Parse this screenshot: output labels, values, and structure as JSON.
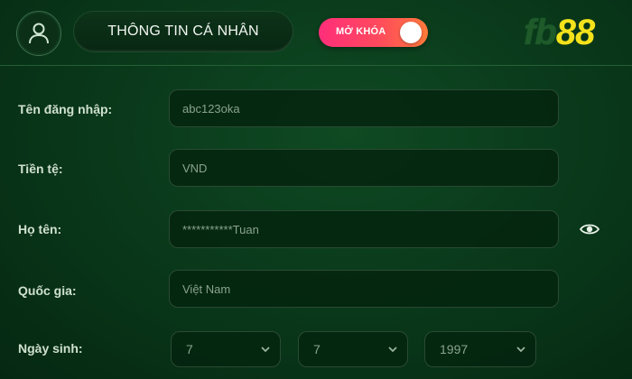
{
  "header": {
    "title": "THÔNG TIN CÁ NHÂN",
    "toggle_label": "MỞ KHÓA",
    "logo_fb": "fb",
    "logo_num": "88",
    "avatar_icon": "user-icon"
  },
  "colors": {
    "background": "#0a3a1b",
    "toggle_gradient_start": "#ff2e7a",
    "toggle_gradient_end": "#ff7a3a",
    "logo_number": "#f4e21b"
  },
  "form": {
    "username": {
      "label": "Tên đăng nhập:",
      "value": "abc123oka"
    },
    "currency": {
      "label": "Tiền tệ:",
      "value": "VND"
    },
    "fullname": {
      "label": "Họ tên:",
      "value": "***********Tuan",
      "reveal_icon": "eye-icon"
    },
    "country": {
      "label": "Quốc gia:",
      "value": "Việt Nam"
    },
    "birthday": {
      "label": "Ngày sinh:",
      "day": "7",
      "month": "7",
      "year": "1997"
    }
  }
}
